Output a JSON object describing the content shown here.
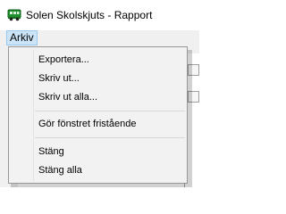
{
  "window": {
    "title": "Solen Skolskjuts - Rapport",
    "icon": "bus-icon"
  },
  "menubar": {
    "items": [
      {
        "label": "Arkiv",
        "open": true
      }
    ]
  },
  "menu": {
    "items": [
      {
        "label": "Exportera..."
      },
      {
        "label": "Skriv ut..."
      },
      {
        "label": "Skriv ut alla..."
      },
      {
        "label": "Gör fönstret fristående"
      },
      {
        "label": "Stäng"
      },
      {
        "label": "Stäng alla"
      }
    ]
  },
  "colors": {
    "menu_highlight": "#cce4f7",
    "menu_border": "#979797",
    "icon_green": "#1f8f2f"
  }
}
